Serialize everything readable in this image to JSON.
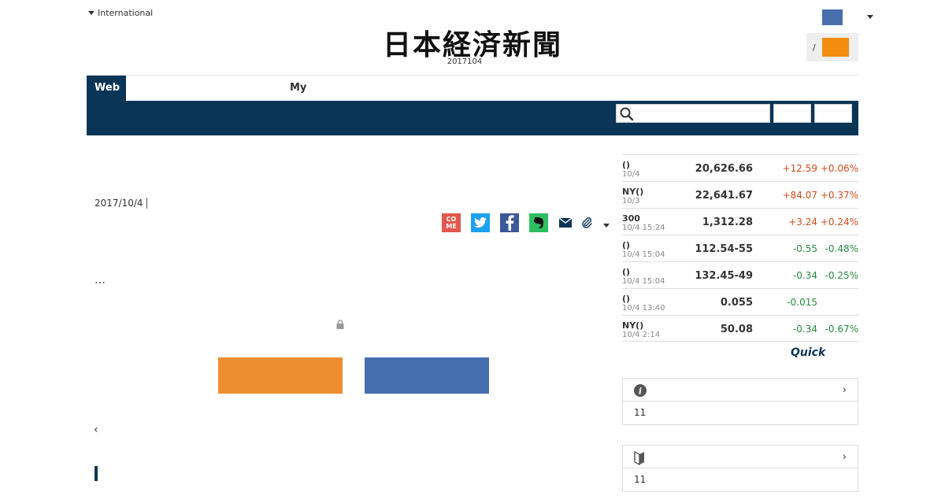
{
  "header": {
    "international_label": "International",
    "logo_text": "日本経済新聞",
    "edition": "2017104",
    "login_separator": "/"
  },
  "nav": {
    "tab_web": "Web",
    "tab_my": "My"
  },
  "article": {
    "date": "2017/10/4",
    "ellipsis": "…",
    "back_glyph": "‹"
  },
  "share": {
    "come_label_top": "CO",
    "come_label_bottom": "ME"
  },
  "market": {
    "rows": [
      {
        "name": "()",
        "time": "10/4",
        "value": "20,626.66",
        "change": "+12.59",
        "pct": "+0.06%",
        "dir": "up"
      },
      {
        "name": "NY()",
        "time": "10/3",
        "value": "22,641.67",
        "change": "+84.07",
        "pct": "+0.37%",
        "dir": "up"
      },
      {
        "name": "300",
        "time": "10/4 15:24",
        "value": "1,312.28",
        "change": "+3.24",
        "pct": "+0.24%",
        "dir": "up"
      },
      {
        "name": "()",
        "time": "10/4 15:04",
        "value": "112.54-55",
        "change": "-0.55",
        "pct": "-0.48%",
        "dir": "down"
      },
      {
        "name": "()",
        "time": "10/4 15:04",
        "value": "132.45-49",
        "change": "-0.34",
        "pct": "-0.25%",
        "dir": "down"
      },
      {
        "name": "()",
        "time": "10/4 13:40",
        "value": "0.055",
        "change": "-0.015",
        "pct": "",
        "dir": "down"
      },
      {
        "name": "NY()",
        "time": "10/4 2:14",
        "value": "50.08",
        "change": "-0.34",
        "pct": "-0.67%",
        "dir": "down"
      }
    ],
    "quick_logo": "Quick"
  },
  "side": {
    "box1_count": "11",
    "box2_count": "11",
    "chevron": "›"
  },
  "colors": {
    "navy": "#0b3556",
    "orange": "#ee8d2f",
    "blue": "#466fb0",
    "up": "#d14b1e",
    "down": "#2a8a3e"
  }
}
